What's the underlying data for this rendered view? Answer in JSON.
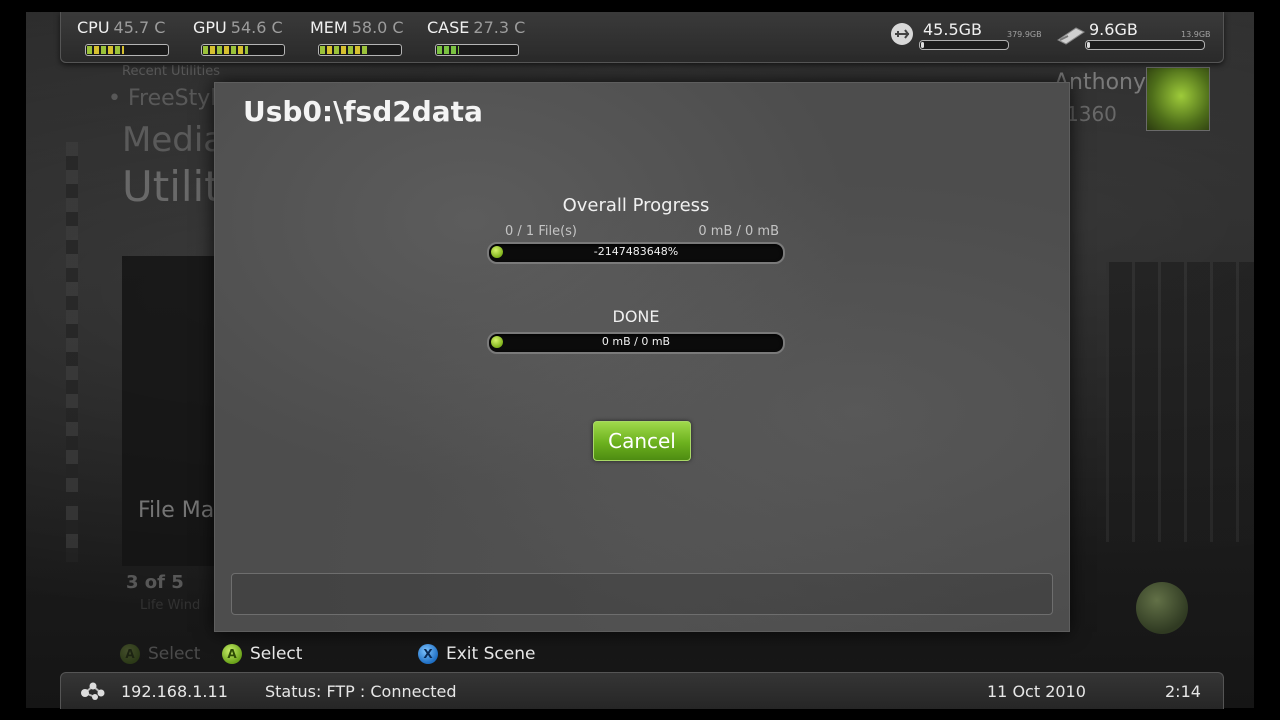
{
  "stats": [
    {
      "label": "CPU",
      "value": "45.7 C",
      "fill": 0.45,
      "warm": true
    },
    {
      "label": "GPU",
      "value": "54.6 C",
      "fill": 0.55,
      "warm": true
    },
    {
      "label": "MEM",
      "value": "58.0 C",
      "fill": 0.58,
      "warm": true
    },
    {
      "label": "CASE",
      "value": "27.3 C",
      "fill": 0.27,
      "warm": false
    }
  ],
  "drives": [
    {
      "icon": "usb-drive-icon",
      "free": "45.5GB",
      "total": "379.9GB"
    },
    {
      "icon": "flash-drive-icon",
      "free": "9.6GB",
      "total": "13.9GB"
    }
  ],
  "background": {
    "recent_label": "Recent Utilities",
    "recent_item": "• FreeStyle",
    "menu_media": "Media",
    "menu_utilities": "Utilities",
    "tile_label": "File Ma",
    "page_counter": "3 of 5",
    "page_sub": "Life Wind",
    "profile_name": "Anthony",
    "profile_score": "1360",
    "ghost_select": "Select"
  },
  "dialog": {
    "title": "Usb0:\\fsd2data",
    "overall": {
      "heading": "Overall Progress",
      "files": "0 / 1 File(s)",
      "size": "0 mB / 0 mB",
      "bar_text": "-2147483648%"
    },
    "current": {
      "heading": "DONE",
      "bar_text": "0 mB / 0 mB"
    },
    "cancel_label": "Cancel",
    "message": ""
  },
  "hints": [
    {
      "button": "A",
      "label": "Select",
      "color": "#7fb21c"
    },
    {
      "button": "X",
      "label": "Exit Scene",
      "color": "#1f6fc4"
    }
  ],
  "status": {
    "ip": "192.168.1.11",
    "text": "Status: FTP : Connected",
    "date": "11 Oct 2010",
    "time": "2:14"
  }
}
